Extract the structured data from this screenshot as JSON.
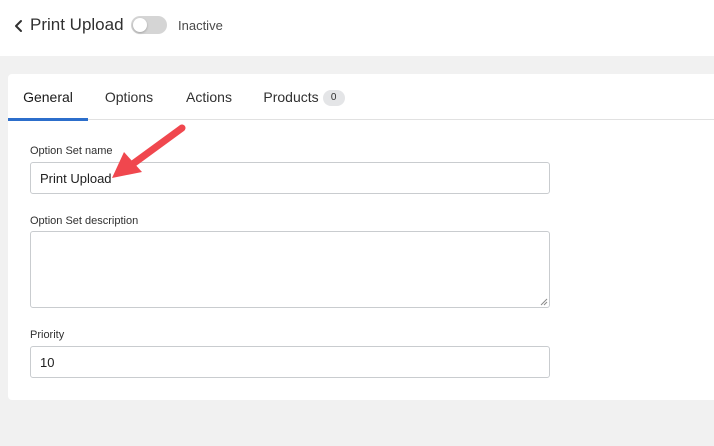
{
  "header": {
    "back_icon": "chevron-left-icon",
    "title": "Print Upload",
    "toggle_on": false,
    "status": "Inactive"
  },
  "tabs": [
    {
      "label": "General",
      "active": true
    },
    {
      "label": "Options",
      "active": false
    },
    {
      "label": "Actions",
      "active": false
    },
    {
      "label": "Products",
      "active": false,
      "count": "0"
    }
  ],
  "form": {
    "name_label": "Option Set name",
    "name_value": "Print Upload",
    "description_label": "Option Set description",
    "description_value": "",
    "priority_label": "Priority",
    "priority_value": "10"
  },
  "annotation": {
    "icon": "red-arrow-icon",
    "color": "#f0474e"
  },
  "colors": {
    "accent": "#2c6ecb",
    "background": "#f1f1f1",
    "toggle_off": "#d5d5d5"
  }
}
